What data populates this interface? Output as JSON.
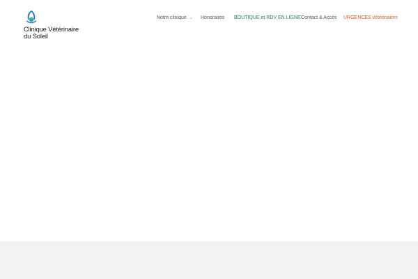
{
  "brand": {
    "name_line1": "Clinique Vétérinaire",
    "name_line2": "du Soleil",
    "logo_icon": "clinic-sun-logo-icon",
    "accent_color": "#2b7fc3"
  },
  "nav": {
    "items": [
      {
        "label": "Notre clinique",
        "has_dropdown": true,
        "dropdown_icon": "chevron-down-icon"
      },
      {
        "label": "Honoraires"
      },
      {
        "label": "BOUTIQUE et RDV EN LIGNE",
        "color": "#1f7a6f"
      },
      {
        "label": "Contact & Accès"
      },
      {
        "label": "URGENCES vétérinaires",
        "color": "#d05a1e"
      }
    ],
    "chevron_glyph": "⌄"
  },
  "colors": {
    "nav_default": "#555555",
    "footer_band": "#f2f2f2"
  }
}
